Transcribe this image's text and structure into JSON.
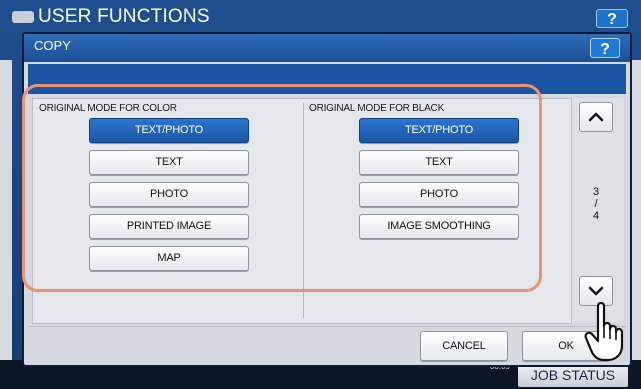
{
  "background": {
    "title": "USER FUNCTIONS",
    "help_label": "?",
    "clock_line1": "",
    "clock_line2": "08:09",
    "job_status": "JOB STATUS"
  },
  "dialog": {
    "title": "COPY",
    "help_label": "?",
    "color_section": {
      "label": "ORIGINAL MODE FOR COLOR",
      "options": [
        "TEXT/PHOTO",
        "TEXT",
        "PHOTO",
        "PRINTED IMAGE",
        "MAP"
      ],
      "selected": "TEXT/PHOTO"
    },
    "black_section": {
      "label": "ORIGINAL MODE FOR BLACK",
      "options": [
        "TEXT/PHOTO",
        "TEXT",
        "PHOTO",
        "IMAGE SMOOTHING"
      ],
      "selected": "TEXT/PHOTO"
    },
    "pager": {
      "current": "3",
      "separator": "/",
      "total": "4"
    },
    "cancel_label": "CANCEL",
    "ok_label": "OK"
  },
  "colors": {
    "selected_button": "#1f63b8",
    "highlight": "#e99373",
    "title_bar": "#2a63ad"
  },
  "icons": [
    "up-arrow-icon",
    "down-arrow-icon",
    "pointing-hand-icon",
    "user-functions-icon"
  ]
}
